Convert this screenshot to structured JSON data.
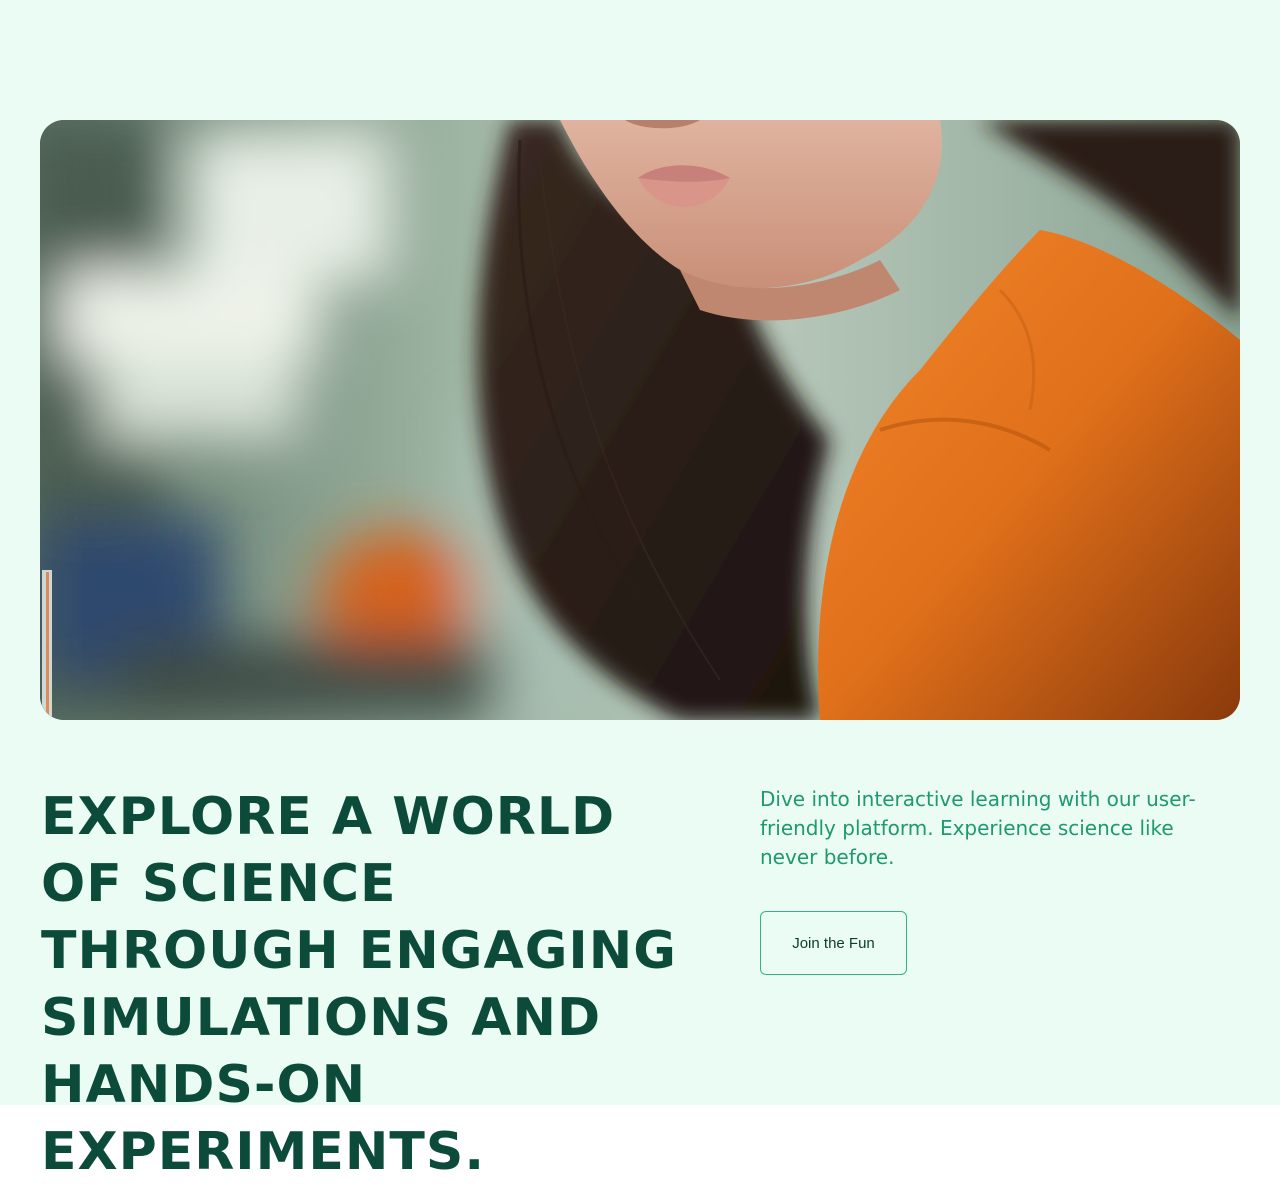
{
  "hero": {
    "image_alt": "Student with long dark hair in an orange shirt sitting in a science lab",
    "headline": "Explore a world of science through engaging simulations and hands-on experiments.",
    "description": "Dive into interactive learning with our user-friendly platform. Experience science like never before.",
    "cta_label": "Join the Fun"
  },
  "colors": {
    "background": "#eafcf3",
    "headline": "#0c4a3a",
    "description": "#1e9a6b",
    "button_border": "#34b38a"
  }
}
